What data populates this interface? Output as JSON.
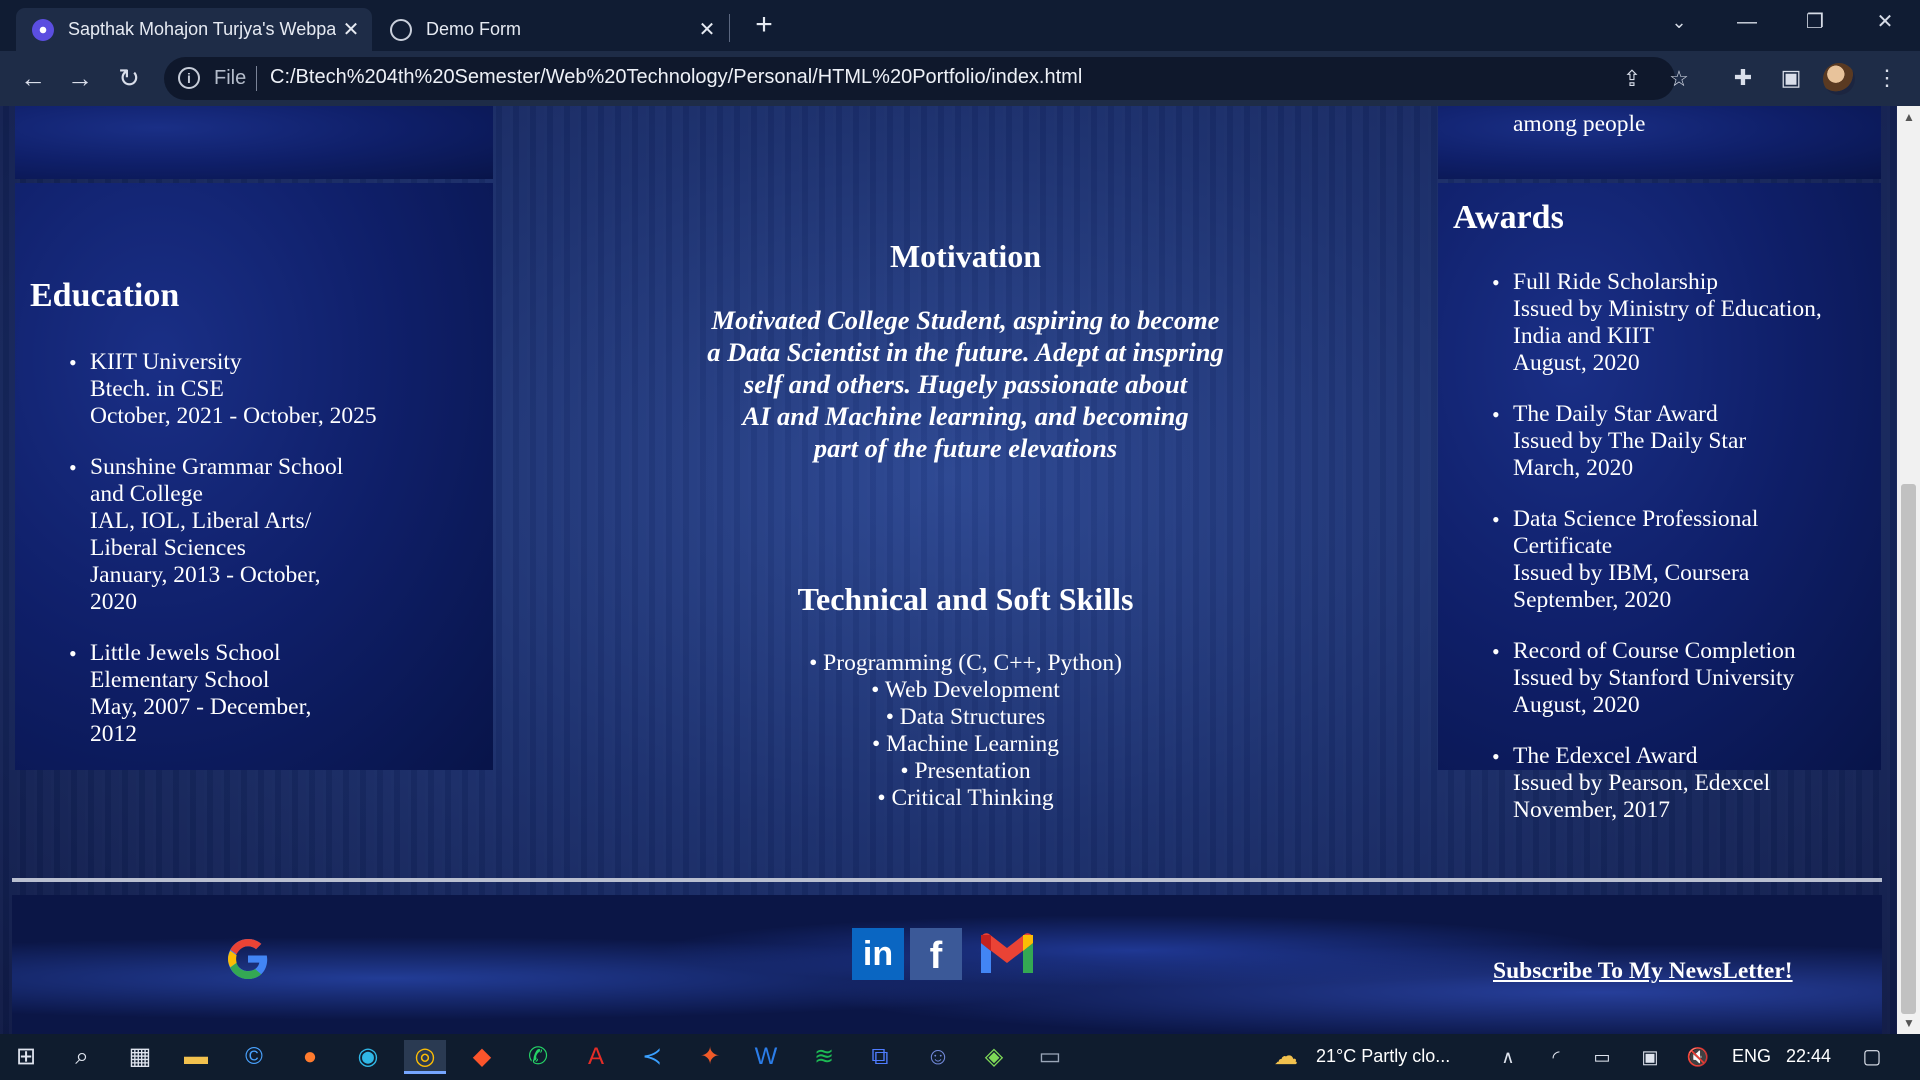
{
  "browser": {
    "tabs": [
      {
        "title": "Sapthak Mohajon Turjya's Webpa",
        "active": true
      },
      {
        "title": "Demo Form",
        "active": false
      }
    ],
    "address": {
      "scheme_label": "File",
      "url": "C:/Btech%204th%20Semester/Web%20Technology/Personal/HTML%20Portfolio/index.html"
    },
    "icons": {
      "back": "back-arrow-icon",
      "forward": "forward-arrow-icon",
      "reload": "reload-icon",
      "share": "share-icon",
      "bookmark": "star-icon",
      "extensions": "puzzle-icon",
      "sidepanel": "side-panel-icon",
      "menu": "kebab-menu-icon"
    }
  },
  "page": {
    "top_right_fragment": "among people",
    "education": {
      "heading": "Education",
      "items": [
        {
          "lines": [
            "KIIT University",
            "Btech. in CSE",
            "October, 2021 - October, 2025"
          ]
        },
        {
          "lines": [
            "Sunshine Grammar School",
            "and College",
            "IAL, IOL, Liberal Arts/",
            "Liberal Sciences",
            "January, 2013 - October,",
            "2020"
          ]
        },
        {
          "lines": [
            "Little Jewels School",
            "Elementary School",
            "May, 2007 - December,",
            "2012"
          ]
        }
      ]
    },
    "motivation": {
      "heading": "Motivation",
      "lines": [
        "Motivated College Student, aspiring to become",
        "a Data Scientist in the future. Adept at inspring",
        "self and others. Hugely passionate about",
        "AI and Machine learning, and becoming",
        "part of the future elevations"
      ]
    },
    "skills": {
      "heading": "Technical and Soft Skills",
      "items": [
        "• Programming (C, C++, Python)",
        "• Web Development",
        "• Data Structures",
        "• Machine Learning",
        "• Presentation",
        "• Critical Thinking"
      ]
    },
    "awards": {
      "heading": "Awards",
      "items": [
        {
          "lines": [
            "Full Ride Scholarship",
            "Issued by Ministry of Education,",
            "India and KIIT",
            "August, 2020"
          ]
        },
        {
          "lines": [
            "The Daily Star Award",
            "Issued by The Daily Star",
            "March, 2020"
          ]
        },
        {
          "lines": [
            "Data Science Professional",
            "Certificate",
            "Issued by IBM, Coursera",
            "September, 2020"
          ]
        },
        {
          "lines": [
            "Record of Course Completion",
            "Issued by Stanford University",
            "August, 2020"
          ]
        },
        {
          "lines": [
            "The Edexcel Award",
            "Issued by Pearson, Edexcel",
            "November, 2017"
          ]
        }
      ]
    },
    "footer": {
      "social": {
        "linkedin": "in",
        "facebook": "f"
      },
      "newsletter_link": "Subscribe To My NewsLetter!"
    }
  },
  "taskbar": {
    "weather": "21°C  Partly clo...",
    "language": "ENG",
    "time": "22:44"
  }
}
